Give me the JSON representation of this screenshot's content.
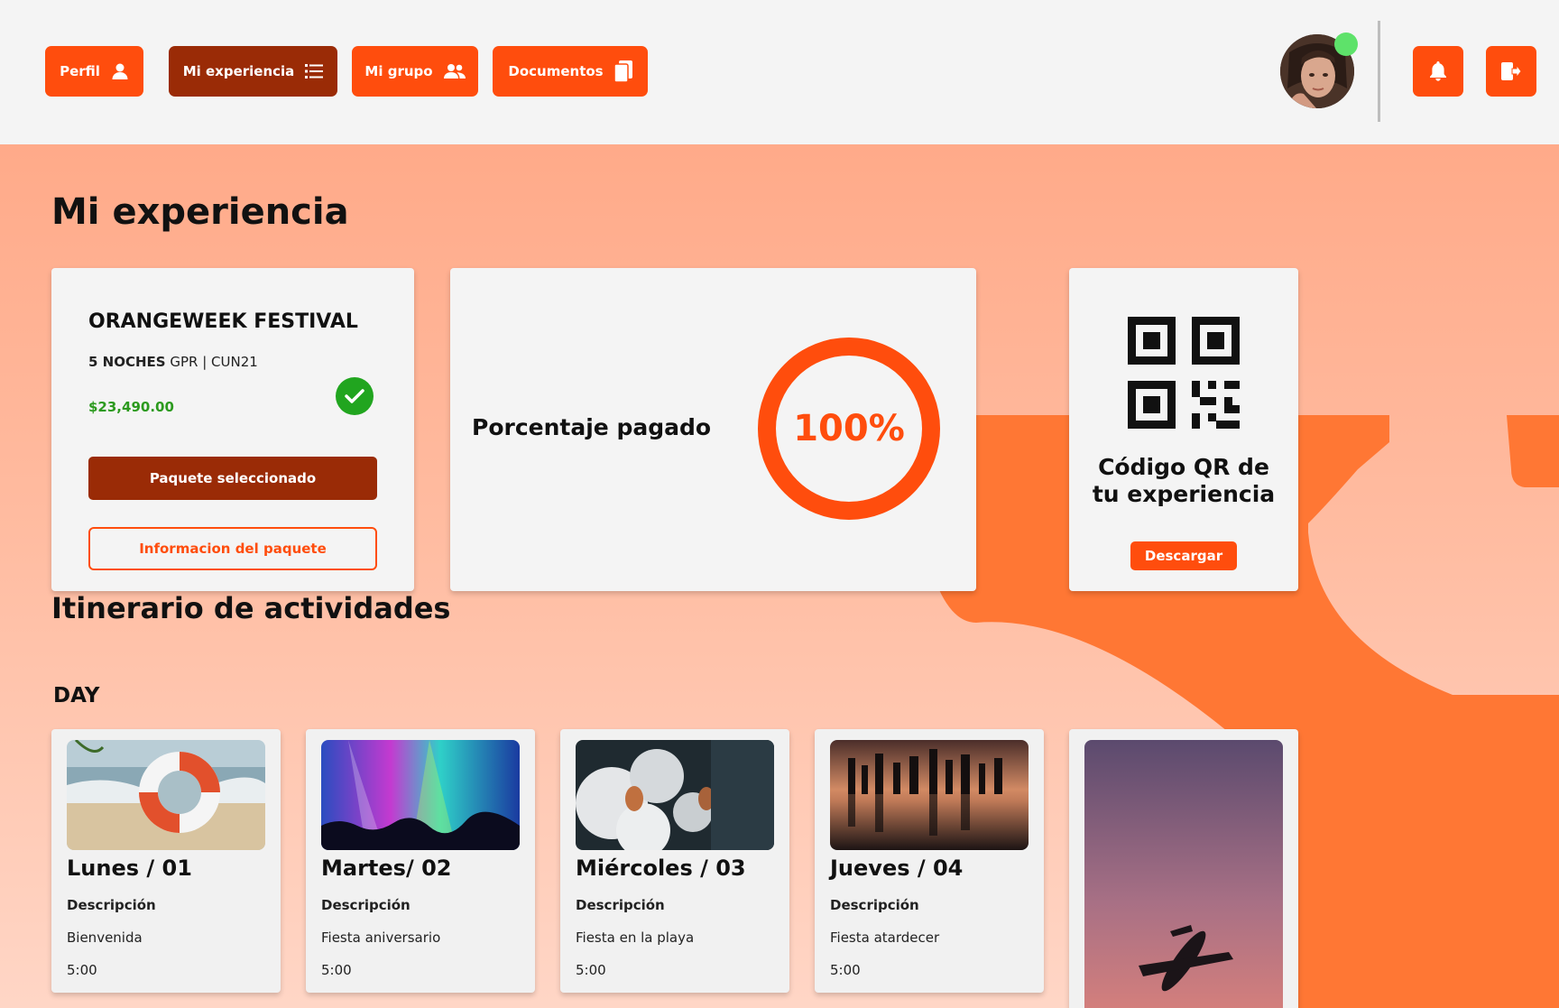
{
  "nav": {
    "perfil": "Perfil",
    "experiencia": "Mi experiencia",
    "grupo": "Mi grupo",
    "documentos": "Documentos"
  },
  "page": {
    "title": "Mi experiencia"
  },
  "package": {
    "name": "ORANGEWEEK FESTIVAL",
    "nights": "5 NOCHES",
    "codes": "GPR | CUN21",
    "price": "$23,490.00",
    "selected_label": "Paquete seleccionado",
    "info_label": "Informacion del paquete"
  },
  "payment": {
    "label": "Porcentaje pagado",
    "percent_text": "100%",
    "percent": 1.0
  },
  "qr": {
    "title_line1": "Código QR de",
    "title_line2": "tu experiencia",
    "download_label": "Descargar"
  },
  "itinerary": {
    "title": "Itinerario de actividades",
    "day_label": "DAY",
    "days": [
      {
        "title": "Lunes / 01",
        "desc_label": "Descripción",
        "desc": "Bienvenida",
        "time": "5:00"
      },
      {
        "title": "Martes/ 02",
        "desc_label": "Descripción",
        "desc": "Fiesta aniversario",
        "time": "5:00"
      },
      {
        "title": "Miércoles / 03",
        "desc_label": "Descripción",
        "desc": "Fiesta en la playa",
        "time": "5:00"
      },
      {
        "title": "Jueves / 04",
        "desc_label": "Descripción",
        "desc": "Fiesta atardecer",
        "time": "5:00"
      }
    ]
  },
  "colors": {
    "accent": "#ff4d0d",
    "accent_dark": "#9a2b06",
    "success": "#21a51f",
    "online": "#5ee26a"
  }
}
